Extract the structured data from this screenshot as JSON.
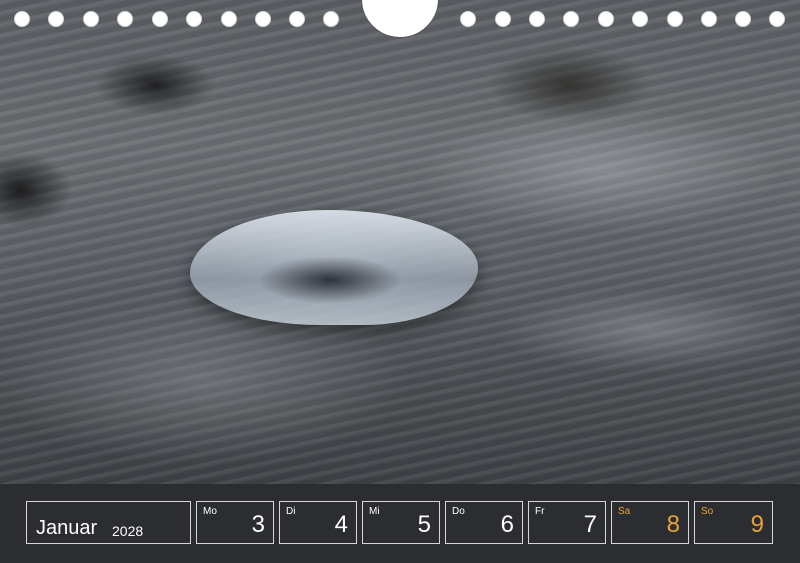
{
  "calendar": {
    "month": "Januar",
    "year": "2028",
    "days": [
      {
        "weekday": "Mo",
        "date": "3",
        "weekend": false
      },
      {
        "weekday": "Di",
        "date": "4",
        "weekend": false
      },
      {
        "weekday": "Mi",
        "date": "5",
        "weekend": false
      },
      {
        "weekday": "Do",
        "date": "6",
        "weekend": false
      },
      {
        "weekday": "Fr",
        "date": "7",
        "weekend": false
      },
      {
        "weekday": "Sa",
        "date": "8",
        "weekend": true
      },
      {
        "weekday": "So",
        "date": "9",
        "weekend": true
      }
    ]
  },
  "colors": {
    "weekend_text": "#e9a23b",
    "weekday_text": "#ffffff",
    "strip_background": "#2b2d30"
  }
}
